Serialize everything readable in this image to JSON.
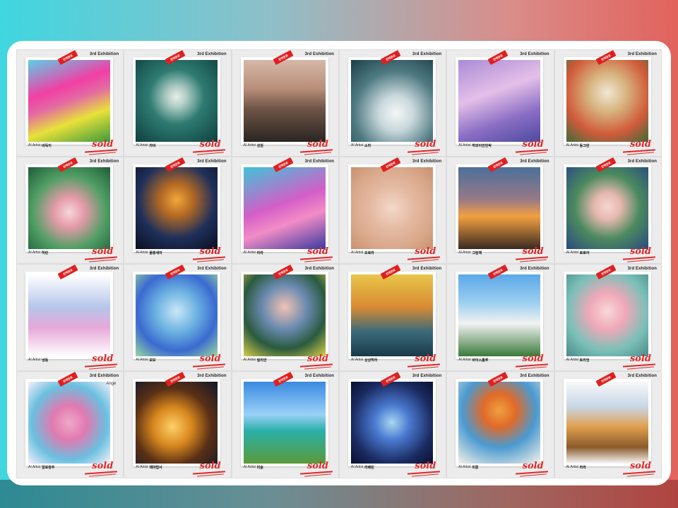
{
  "exhibition_label": "3rd Exhibition",
  "artist_label": "AI Artist",
  "sold_label": "sold",
  "tag_label": "판매완료",
  "accent_color": "#e02828",
  "cards": [
    {
      "title": "바둑이",
      "art": "linear-gradient(160deg,#5ad0e8 0%,#f23fa5 35%,#e36aa3 50%,#e8e13a 70%,#3f9a3a 100%)"
    },
    {
      "title": "라바",
      "art": "radial-gradient(circle at 50% 45%,#e9efe9 0%,#a8c8c0 18%,#2e7b72 45%,#0f3f3d 100%)"
    },
    {
      "title": "성원",
      "art": "linear-gradient(180deg,#d6b8a8 0%,#b88e7a 35%,#6e5446 60%,#2a2521 100%)"
    },
    {
      "title": "소라",
      "art": "radial-gradient(circle at 55% 65%,#f4f6f6 0%,#c9d8dc 25%,#4f7a82 60%,#1c3f46 100%)"
    },
    {
      "title": "하와이안민박",
      "art": "linear-gradient(160deg,#a98bd6 0%,#e4c0e8 40%,#8a6ec4 70%,#4d4aa0 100%)"
    },
    {
      "title": "동그란",
      "art": "radial-gradient(circle at 50% 40%,#f0e7d4 0%,#d7b47f 30%,#d05b3a 65%,#3d6b3a 100%)"
    },
    {
      "title": "하린",
      "art": "radial-gradient(circle at 50% 55%,#f7d6db 0%,#e49aa8 25%,#4f9e64 60%,#205c38 100%)"
    },
    {
      "title": "물총새아",
      "art": "radial-gradient(circle at 50% 40%,#f0a83a 0%,#b46a24 25%,#1e2f5a 60%,#0b1020 100%)"
    },
    {
      "title": "라라",
      "art": "linear-gradient(160deg,#3fc4d8 0%,#d35ec8 45%,#f28cc6 65%,#3a3aa0 100%)"
    },
    {
      "title": "오로라",
      "art": "radial-gradient(circle at 50% 50%,#f2d8c8 0%,#e4b8a0 40%,#d8a88a 70%,#c9906e 100%)"
    },
    {
      "title": "그림책",
      "art": "linear-gradient(180deg,#4a6f9a 0%,#9a7a86 40%,#f2a040 60%,#3a2a22 100%)"
    },
    {
      "title": "로로아",
      "art": "radial-gradient(circle at 50% 48%,#f3d7cf 0%,#e7b8b0 22%,#4b8a5e 55%,#2a4a80 100%)"
    },
    {
      "title": "냉동",
      "art": "linear-gradient(180deg,#ffffff 0%,#b6c6ea 40%,#e6a8d8 65%,#ffffff 100%)"
    },
    {
      "title": "모모",
      "art": "radial-gradient(circle at 50% 45%,#c9e8f6 0%,#6ab0e0 35%,#3a6ad0 65%,#9ad8a0 100%)"
    },
    {
      "title": "밀리안",
      "art": "radial-gradient(circle at 50% 40%,#f2c2b2 0%,#6a8ab0 35%,#2a5a3e 65%,#d8d04a 100%)"
    },
    {
      "title": "상상하라",
      "art": "linear-gradient(180deg,#e8c64a 0%,#d88a32 40%,#3a6a7a 70%,#1a3a48 100%)"
    },
    {
      "title": "바이스롤루",
      "art": "linear-gradient(180deg,#5aa8e8 0%,#9ed0f0 35%,#f2f2f2 60%,#3a7a3a 100%)"
    },
    {
      "title": "토리엉",
      "art": "radial-gradient(circle at 50% 45%,#f6d8d8 0%,#f0a8b8 30%,#7ac0b8 65%,#4a8a8a 100%)"
    },
    {
      "title": "알로랑주",
      "art": "radial-gradient(circle at 50% 50%,#f0a8c8 0%,#e07ab0 30%,#6ac0e0 65%,#f8f0f8 100%)"
    },
    {
      "title": "책마법사",
      "art": "radial-gradient(circle at 45% 55%,#ffd06a 0%,#d8881e 30%,#5a3016 60%,#101828 100%)"
    },
    {
      "title": "미술",
      "art": "linear-gradient(180deg,#3a8ae0 0%,#9ad0f8 40%,#2ab0a8 60%,#5a9a3a 100%)"
    },
    {
      "title": "라베린",
      "art": "radial-gradient(circle at 50% 50%,#a8d8f0 0%,#4a7ad0 30%,#1a2a60 70%,#0a1030 100%)"
    },
    {
      "title": "미롱",
      "art": "radial-gradient(circle at 50% 35%,#f0a040 0%,#e06a2a 25%,#4a9ad0 55%,#f8f2e8 100%)"
    },
    {
      "title": "라라",
      "art": "linear-gradient(180deg,#f8f8f8 0%,#c8d8e8 30%,#e0a050 55%,#8a5a2a 80%,#f8f8f8 100%)"
    }
  ],
  "special_note": "Ange"
}
